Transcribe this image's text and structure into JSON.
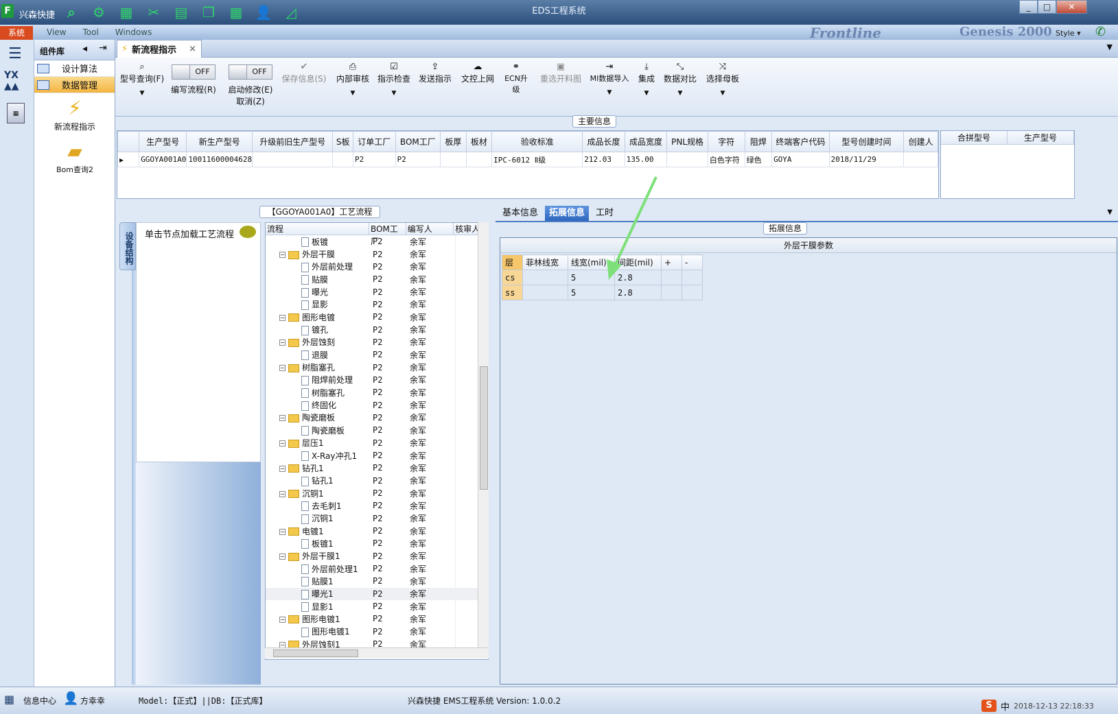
{
  "titlebar": {
    "logo": "F",
    "app_name": "兴森快捷",
    "window_title": "EDS工程系统",
    "min": "_",
    "max": "□",
    "close": "✕"
  },
  "menustrip": {
    "system": "系统",
    "items": [
      "View",
      "Tool",
      "Windows"
    ],
    "brand": "Frontline",
    "brand2": "Genesis 2000",
    "style": "Style ▾"
  },
  "complib": {
    "title": "组件库",
    "nav": [
      {
        "label": "设计算法"
      },
      {
        "label": "数据管理"
      }
    ],
    "tools": [
      {
        "label": "新流程指示",
        "icon": "⚡"
      },
      {
        "label": "Bom查询2",
        "icon": "📂"
      }
    ]
  },
  "doctab": {
    "label": "新流程指示",
    "close": "×"
  },
  "ribbon": {
    "query": "型号查询(F)",
    "edit_flow": "编写流程(R)",
    "edit_flow_state": "OFF",
    "start_modify": "启动修改(E)",
    "cancel": "取消(Z)",
    "start_modify_state": "OFF",
    "save": "保存信息(S)",
    "internal_review": "内部审核",
    "instruction_check": "指示检查",
    "send_instruction": "发送指示",
    "upload": "文控上网",
    "ecn": "ECN升级",
    "reselect": "重选开料图",
    "mi_import": "MI数据导入",
    "integrate": "集成",
    "compare": "数据对比",
    "select_master": "选择母板"
  },
  "main_info": {
    "title": "主要信息",
    "columns": [
      "生产型号",
      "新生产型号",
      "升级前旧生产型号",
      "S板",
      "订单工厂",
      "BOM工厂",
      "板厚",
      "板材",
      "验收标准",
      "成品长度",
      "成品宽度",
      "PNL规格",
      "字符",
      "阻焊",
      "终端客户代码",
      "型号创建时间",
      "创建人"
    ],
    "row": [
      "GGOYA001A0",
      "10011600004628",
      "",
      "",
      "P2",
      "P2",
      "",
      "",
      "IPC-6012 Ⅱ级",
      "212.03",
      "135.00",
      "",
      "白色字符",
      "绿色",
      "GOYA",
      "2018/11/29",
      ""
    ],
    "side_columns": [
      "合拼型号",
      "生产型号"
    ]
  },
  "process": {
    "title": "【GGOYA001A0】工艺流程",
    "vtab": "设备结构",
    "hint": "单击节点加载工艺流程",
    "columns": [
      "流程",
      "BOM工厂",
      "编写人",
      "核审人"
    ],
    "rows": [
      {
        "name": "板镀",
        "type": "doc",
        "bom": "P2",
        "author": "余军"
      },
      {
        "name": "外层干膜",
        "type": "folder",
        "bom": "P2",
        "author": "余军"
      },
      {
        "name": "外层前处理",
        "type": "doc",
        "bom": "P2",
        "author": "余军"
      },
      {
        "name": "贴膜",
        "type": "doc",
        "bom": "P2",
        "author": "余军"
      },
      {
        "name": "曝光",
        "type": "doc",
        "bom": "P2",
        "author": "余军"
      },
      {
        "name": "显影",
        "type": "doc",
        "bom": "P2",
        "author": "余军"
      },
      {
        "name": "图形电镀",
        "type": "folder",
        "bom": "P2",
        "author": "余军"
      },
      {
        "name": "镀孔",
        "type": "doc",
        "bom": "P2",
        "author": "余军"
      },
      {
        "name": "外层蚀刻",
        "type": "folder",
        "bom": "P2",
        "author": "余军"
      },
      {
        "name": "退膜",
        "type": "doc",
        "bom": "P2",
        "author": "余军"
      },
      {
        "name": "树脂塞孔",
        "type": "folder",
        "bom": "P2",
        "author": "余军"
      },
      {
        "name": "阻焊前处理",
        "type": "doc",
        "bom": "P2",
        "author": "余军"
      },
      {
        "name": "树脂塞孔",
        "type": "doc",
        "bom": "P2",
        "author": "余军"
      },
      {
        "name": "终固化",
        "type": "doc",
        "bom": "P2",
        "author": "余军"
      },
      {
        "name": "陶瓷磨板",
        "type": "folder",
        "bom": "P2",
        "author": "余军"
      },
      {
        "name": "陶瓷磨板",
        "type": "doc",
        "bom": "P2",
        "author": "余军"
      },
      {
        "name": "层压1",
        "type": "folder",
        "bom": "P2",
        "author": "余军"
      },
      {
        "name": "X-Ray冲孔1",
        "type": "doc",
        "bom": "P2",
        "author": "余军"
      },
      {
        "name": "钻孔1",
        "type": "folder",
        "bom": "P2",
        "author": "余军"
      },
      {
        "name": "钻孔1",
        "type": "doc",
        "bom": "P2",
        "author": "余军"
      },
      {
        "name": "沉铜1",
        "type": "folder",
        "bom": "P2",
        "author": "余军"
      },
      {
        "name": "去毛刺1",
        "type": "doc",
        "bom": "P2",
        "author": "余军"
      },
      {
        "name": "沉铜1",
        "type": "doc",
        "bom": "P2",
        "author": "余军"
      },
      {
        "name": "电镀1",
        "type": "folder",
        "bom": "P2",
        "author": "余军"
      },
      {
        "name": "板镀1",
        "type": "doc",
        "bom": "P2",
        "author": "余军"
      },
      {
        "name": "外层干膜1",
        "type": "folder",
        "bom": "P2",
        "author": "余军"
      },
      {
        "name": "外层前处理1",
        "type": "doc",
        "bom": "P2",
        "author": "余军"
      },
      {
        "name": "贴膜1",
        "type": "doc",
        "bom": "P2",
        "author": "余军"
      },
      {
        "name": "曝光1",
        "type": "doc",
        "bom": "P2",
        "author": "余军",
        "selected": true
      },
      {
        "name": "显影1",
        "type": "doc",
        "bom": "P2",
        "author": "余军"
      },
      {
        "name": "图形电镀1",
        "type": "folder",
        "bom": "P2",
        "author": "余军"
      },
      {
        "name": "图形电镀1",
        "type": "doc",
        "bom": "P2",
        "author": "余军"
      },
      {
        "name": "外层蚀刻1",
        "type": "folder",
        "bom": "P2",
        "author": "余军"
      }
    ]
  },
  "right_tabs": {
    "tabs": [
      "基本信息",
      "拓展信息",
      "工时"
    ],
    "active": 1,
    "ext_title": "拓展信息",
    "group": "外层干膜参数",
    "columns": [
      "层",
      "菲林线宽",
      "线宽(mil)",
      "间距(mil)",
      "+",
      "-"
    ],
    "rows": [
      [
        "cs",
        "",
        "5",
        "2.8",
        "",
        ""
      ],
      [
        "ss",
        "",
        "5",
        "2.8",
        "",
        ""
      ]
    ]
  },
  "statusbar": {
    "info_center": "信息中心",
    "user": "方幸幸",
    "model": "Model:【正式】||DB:【正式库】",
    "version": "兴森快捷 EMS工程系统 Version: 1.0.0.2",
    "datetime": "2018-12-13 22:18:33",
    "ime": "中"
  },
  "colors": {
    "accent": "#2e67bf",
    "highlight": "#f4b540",
    "arrow": "#7ee07a"
  }
}
